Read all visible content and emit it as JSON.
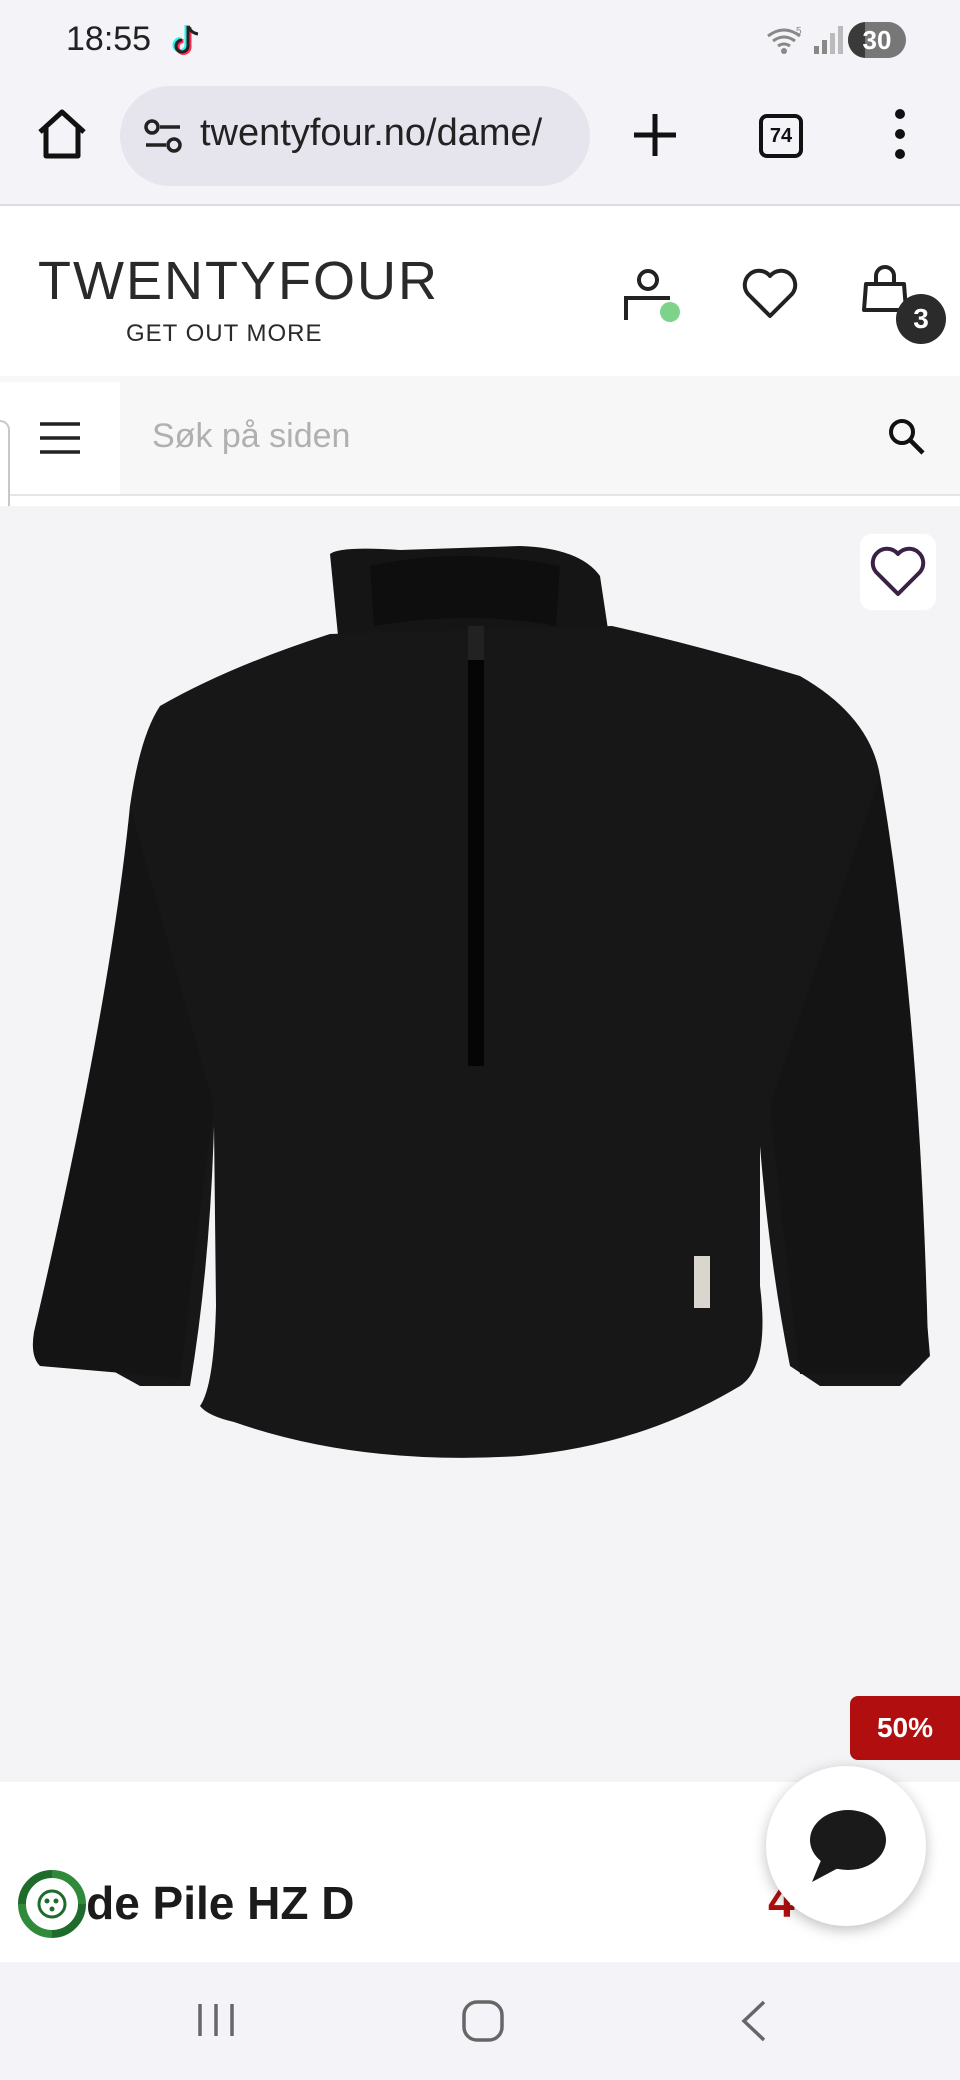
{
  "status_bar": {
    "time": "18:55",
    "battery_level": "30",
    "battery_fraction": 0.3,
    "icons": [
      "tiktok-icon",
      "wifi-icon",
      "signal-icon",
      "battery-icon"
    ]
  },
  "browser": {
    "url": "twentyfour.no/dame/",
    "tab_count": "74",
    "icons": [
      "home-icon",
      "site-settings-icon",
      "plus-icon",
      "tabs-icon",
      "more-vertical-icon"
    ]
  },
  "site_header": {
    "logo_wordmark": "TWENTYFOUR",
    "logo_tagline": "GET OUT MORE",
    "cart_count": "3",
    "account_status_color": "#7ed38a",
    "icons": [
      "account-icon",
      "heart-icon",
      "shopping-bag-icon"
    ]
  },
  "search": {
    "placeholder": "Søk på siden",
    "value": ""
  },
  "product": {
    "image_bg": "#f4f4f6",
    "discount_badge": "50%",
    "name": "ode Pile HZ D",
    "price": "4",
    "accent_color": "#b10f0f"
  }
}
